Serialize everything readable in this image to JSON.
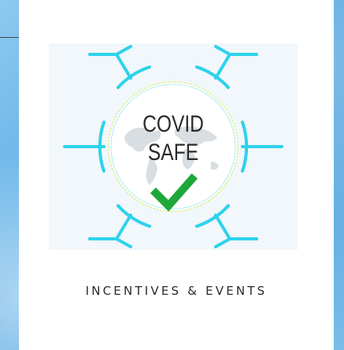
{
  "badge": {
    "line1": "COVID",
    "line2": "SAFE"
  },
  "caption": "INCENTIVES & EVENTS",
  "colors": {
    "ring": "#2ed2ec",
    "check": "#1ea83a",
    "text": "#2b2b2b"
  },
  "icons": [
    "covid-safe-badge-icon",
    "checkmark-icon",
    "world-map-icon"
  ]
}
